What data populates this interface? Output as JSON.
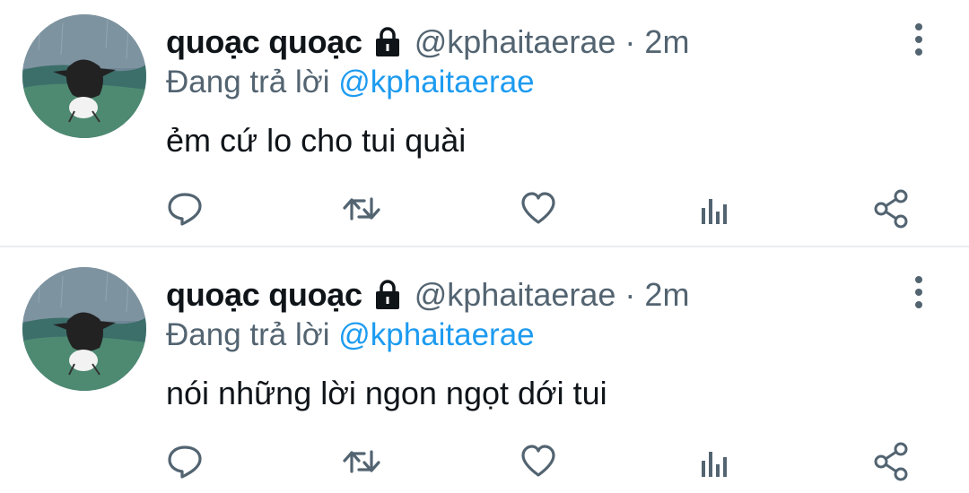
{
  "tweets": [
    {
      "display_name": "quoạc quoạc",
      "handle": "@kphaitaerae",
      "separator": "·",
      "time": "2m",
      "reply_prefix": "Đang trả lời",
      "reply_to": "@kphaitaerae",
      "text": "ẻm cứ lo cho tui quài"
    },
    {
      "display_name": "quoạc quoạc",
      "handle": "@kphaitaerae",
      "separator": "·",
      "time": "2m",
      "reply_prefix": "Đang trả lời",
      "reply_to": "@kphaitaerae",
      "text": "nói những lời ngon ngọt dới tui"
    }
  ],
  "icons": {
    "protected": "lock-icon",
    "more": "more-vertical-icon",
    "reply": "reply-icon",
    "retweet": "retweet-icon",
    "like": "like-icon",
    "views": "views-icon",
    "share": "share-icon"
  },
  "colors": {
    "text": "#0f1419",
    "secondary": "#536471",
    "mention": "#1d9bf0",
    "divider": "#e9ecef"
  }
}
